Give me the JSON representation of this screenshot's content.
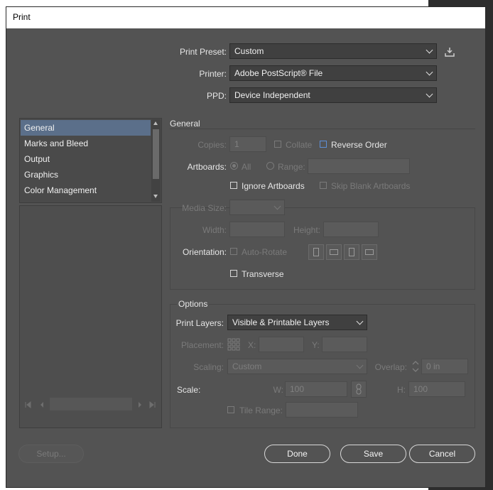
{
  "window": {
    "title": "Print"
  },
  "print_preset": {
    "label": "Print Preset:",
    "value": "Custom"
  },
  "printer": {
    "label": "Printer:",
    "value": "Adobe PostScript® File"
  },
  "ppd": {
    "label": "PPD:",
    "value": "Device Independent"
  },
  "sidebar": {
    "items": [
      {
        "label": "General",
        "selected": true
      },
      {
        "label": "Marks and Bleed"
      },
      {
        "label": "Output"
      },
      {
        "label": "Graphics"
      },
      {
        "label": "Color Management"
      }
    ]
  },
  "general": {
    "heading": "General",
    "copies_label": "Copies:",
    "copies_value": "1",
    "collate_label": "Collate",
    "reverse_order_label": "Reverse Order",
    "artboards_label": "Artboards:",
    "all_label": "All",
    "range_label": "Range:",
    "ignore_artboards_label": "Ignore Artboards",
    "skip_blank_label": "Skip Blank Artboards"
  },
  "media": {
    "size_label": "Media Size:",
    "width_label": "Width:",
    "height_label": "Height:",
    "orientation_label": "Orientation:",
    "auto_rotate_label": "Auto-Rotate",
    "transverse_label": "Transverse"
  },
  "options": {
    "heading": "Options",
    "print_layers_label": "Print Layers:",
    "print_layers_value": "Visible & Printable Layers",
    "placement_label": "Placement:",
    "x_label": "X:",
    "y_label": "Y:",
    "scaling_label": "Scaling:",
    "scaling_value": "Custom",
    "overlap_label": "Overlap:",
    "overlap_value": "0 in",
    "scale_label": "Scale:",
    "w_label": "W:",
    "w_value": "100",
    "h_label": "H:",
    "h_value": "100",
    "tile_range_label": "Tile Range:"
  },
  "buttons": {
    "setup": "Setup...",
    "done": "Done",
    "save": "Save",
    "cancel": "Cancel"
  },
  "colors": {
    "dialog_bg": "#535353",
    "selection": "#5b6f8a",
    "accent_checkbox": "#5d8fd8"
  }
}
